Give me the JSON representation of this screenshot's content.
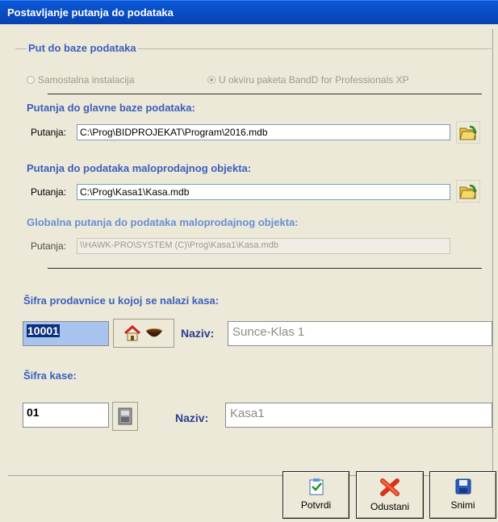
{
  "window": {
    "title": "Postavljanje putanja do podataka"
  },
  "group": {
    "legend": "Put do baze podataka",
    "radio_standalone": "Samostalna instalacija",
    "radio_package": "U okviru paketa BandD for Professionals XP",
    "selected_radio": "package"
  },
  "main_db": {
    "heading": "Putanja do glavne baze podataka:",
    "label": "Putanja:",
    "value": "C:\\Prog\\BIDPROJEKAT\\Program\\2016.mdb"
  },
  "store_db": {
    "heading": "Putanja do podataka maloprodajnog objekta:",
    "label": "Putanja:",
    "value": "C:\\Prog\\Kasa1\\Kasa.mdb"
  },
  "global_db": {
    "heading": "Globalna putanja do podataka maloprodajnog objekta:",
    "label": "Putanja:",
    "value": "\\\\HAWK-PRO\\SYSTEM (C)\\Prog\\Kasa1\\Kasa.mdb"
  },
  "store": {
    "heading": "Šifra prodavnice u kojoj se nalazi kasa:",
    "code": "10001",
    "name_label": "Naziv:",
    "name": "Sunce-Klas 1"
  },
  "register": {
    "heading": "Šifra kase:",
    "code": "01",
    "name_label": "Naziv:",
    "name": "Kasa1"
  },
  "buttons": {
    "confirm": "Potvrdi",
    "cancel": "Odustani",
    "save": "Snimi"
  },
  "icons": [
    "folder-open-icon",
    "house-icon",
    "coffee-icon",
    "cash-register-icon",
    "checklist-icon",
    "red-x-icon",
    "floppy-disk-icon"
  ],
  "colors": {
    "title_bar": "#0a59d8",
    "section_heading": "#3b5fbd",
    "selection": "#0b2d7a"
  }
}
